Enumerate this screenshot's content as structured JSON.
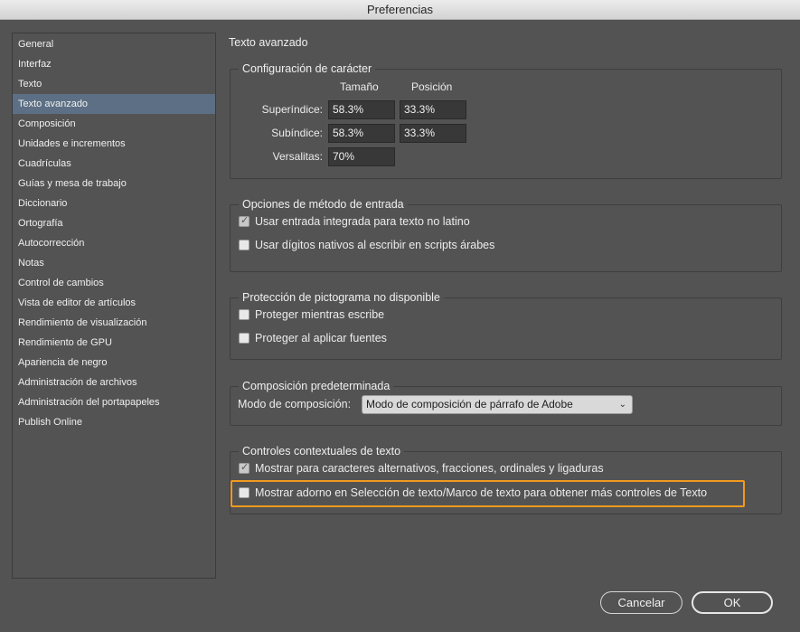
{
  "window": {
    "title": "Preferencias"
  },
  "sidebar": {
    "items": [
      "General",
      "Interfaz",
      "Texto",
      "Texto avanzado",
      "Composición",
      "Unidades e incrementos",
      "Cuadrículas",
      "Guías y mesa de trabajo",
      "Diccionario",
      "Ortografía",
      "Autocorrección",
      "Notas",
      "Control de cambios",
      "Vista de editor de artículos",
      "Rendimiento de visualización",
      "Rendimiento de GPU",
      "Apariencia de negro",
      "Administración de archivos",
      "Administración del portapapeles",
      "Publish Online"
    ],
    "selected": "Texto avanzado"
  },
  "section": {
    "title": "Texto avanzado"
  },
  "char_settings": {
    "title": "Configuración de carácter",
    "col_size": "Tamaño",
    "col_position": "Posición",
    "superscript_label": "Superíndice:",
    "superscript_size": "58.3%",
    "superscript_position": "33.3%",
    "subscript_label": "Subíndice:",
    "subscript_size": "58.3%",
    "subscript_position": "33.3%",
    "smallcaps_label": "Versalitas:",
    "smallcaps_size": "70%"
  },
  "input_method": {
    "title": "Opciones de método de entrada",
    "opt1": {
      "label": "Usar entrada integrada para texto no latino",
      "checked": true
    },
    "opt2": {
      "label": "Usar dígitos nativos al escribir en scripts árabes",
      "checked": false
    }
  },
  "glyph_protection": {
    "title": "Protección de pictograma no disponible",
    "opt1": {
      "label": "Proteger mientras escribe",
      "checked": false
    },
    "opt2": {
      "label": "Proteger al aplicar fuentes",
      "checked": false
    }
  },
  "default_composer": {
    "title": "Composición predeterminada",
    "mode_label": "Modo de composición:",
    "mode_value": "Modo de composición de párrafo de Adobe"
  },
  "contextual_controls": {
    "title": "Controles contextuales de texto",
    "opt1": {
      "label": "Mostrar para caracteres alternativos, fracciones, ordinales y ligaduras",
      "checked": true
    },
    "opt2": {
      "label": "Mostrar adorno en Selección de texto/Marco de texto para obtener más controles de Texto",
      "checked": false
    }
  },
  "buttons": {
    "cancel": "Cancelar",
    "ok": "OK"
  },
  "colors": {
    "highlight": "#f29a1e",
    "selection": "#5c6f84",
    "background": "#535353"
  }
}
